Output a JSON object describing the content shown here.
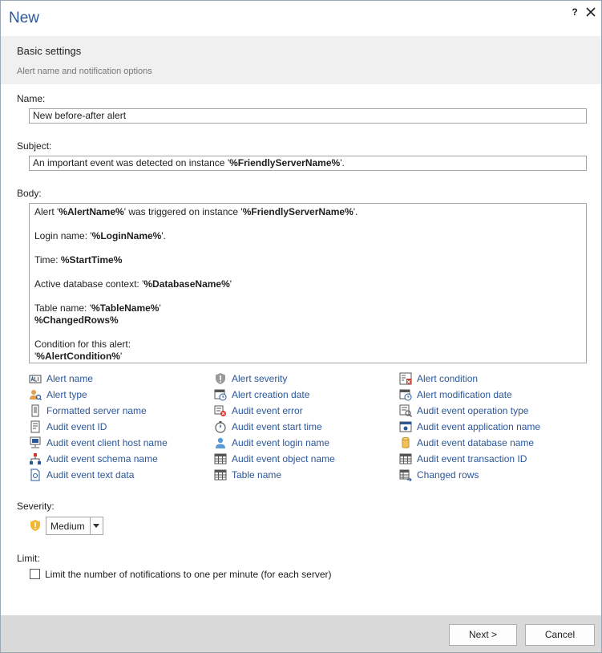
{
  "window": {
    "title": "New",
    "help_label": "?"
  },
  "header": {
    "title": "Basic settings",
    "subtitle": "Alert name and notification options"
  },
  "form": {
    "name_label": "Name:",
    "name_value": "New before-after alert",
    "subject_label": "Subject:",
    "subject_prefix": "An important event was detected on instance '",
    "subject_var": "%FriendlyServerName%",
    "subject_suffix": "'.",
    "body_label": "Body:",
    "body": {
      "l1_a": "Alert '",
      "l1_var1": "%AlertName%",
      "l1_b": "' was triggered on instance '",
      "l1_var2": "%FriendlyServerName%",
      "l1_c": "'.",
      "l2_a": "Login name: '",
      "l2_var": "%LoginName%",
      "l2_b": "'.",
      "l3_a": "Time: ",
      "l3_var": "%StartTime%",
      "l4_a": "Active database context: '",
      "l4_var": "%DatabaseName%",
      "l4_b": "'",
      "l5_a": "Table name: '",
      "l5_var": "%TableName%",
      "l5_b": "'",
      "l6_var": "%ChangedRows%",
      "l7_a": "Condition for this alert:",
      "l8_a": "'",
      "l8_var": "%AlertCondition%",
      "l8_b": "'"
    }
  },
  "variables": [
    {
      "label": "Alert name",
      "icon": "alert-name-icon"
    },
    {
      "label": "Alert severity",
      "icon": "alert-severity-icon"
    },
    {
      "label": "Alert condition",
      "icon": "alert-condition-icon"
    },
    {
      "label": "Alert type",
      "icon": "alert-type-icon"
    },
    {
      "label": "Alert creation date",
      "icon": "calendar-clock-icon"
    },
    {
      "label": "Alert modification date",
      "icon": "calendar-clock-icon"
    },
    {
      "label": "Formatted server name",
      "icon": "server-icon"
    },
    {
      "label": "Audit event error",
      "icon": "error-icon"
    },
    {
      "label": "Audit event operation type",
      "icon": "operation-type-icon"
    },
    {
      "label": "Audit event ID",
      "icon": "event-id-icon"
    },
    {
      "label": "Audit event start time",
      "icon": "stopwatch-icon"
    },
    {
      "label": "Audit event application name",
      "icon": "application-icon"
    },
    {
      "label": "Audit event client host name",
      "icon": "client-host-icon"
    },
    {
      "label": "Audit event login name",
      "icon": "user-icon"
    },
    {
      "label": "Audit event database name",
      "icon": "database-icon"
    },
    {
      "label": "Audit event schema name",
      "icon": "schema-icon"
    },
    {
      "label": "Audit event object name",
      "icon": "table-icon"
    },
    {
      "label": "Audit event transaction ID",
      "icon": "transaction-icon"
    },
    {
      "label": "Audit event text data",
      "icon": "text-data-icon"
    },
    {
      "label": "Table name",
      "icon": "table-icon"
    },
    {
      "label": "Changed rows",
      "icon": "changed-rows-icon"
    }
  ],
  "severity": {
    "label": "Severity:",
    "value": "Medium",
    "icon": "shield-warning-icon",
    "color": "#f2b632"
  },
  "limit": {
    "label": "Limit:",
    "checkbox_label": "Limit the number of notifications to one per minute (for each server)",
    "checked": false
  },
  "buttons": {
    "next": "Next >",
    "cancel": "Cancel"
  },
  "colors": {
    "accent": "#2b579a",
    "header_bg": "#f0f0f0",
    "footer_bg": "#d9d9d9"
  }
}
